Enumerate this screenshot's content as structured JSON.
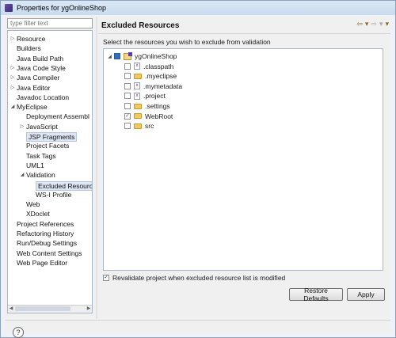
{
  "window": {
    "title": "Properties for ygOnlineShop"
  },
  "filter": {
    "placeholder": "type filter text"
  },
  "nav_tree": [
    {
      "label": "Resource",
      "indent": 0,
      "arrow": "▷"
    },
    {
      "label": "Builders",
      "indent": 0,
      "arrow": ""
    },
    {
      "label": "Java Build Path",
      "indent": 0,
      "arrow": ""
    },
    {
      "label": "Java Code Style",
      "indent": 0,
      "arrow": "▷"
    },
    {
      "label": "Java Compiler",
      "indent": 0,
      "arrow": "▷"
    },
    {
      "label": "Java Editor",
      "indent": 0,
      "arrow": "▷"
    },
    {
      "label": "Javadoc Location",
      "indent": 0,
      "arrow": ""
    },
    {
      "label": "MyEclipse",
      "indent": 0,
      "arrow": "◢"
    },
    {
      "label": "Deployment Assembl",
      "indent": 1,
      "arrow": ""
    },
    {
      "label": "JavaScript",
      "indent": 1,
      "arrow": "▷"
    },
    {
      "label": "JSP Fragments",
      "indent": 1,
      "arrow": "",
      "selected": true
    },
    {
      "label": "Project Facets",
      "indent": 1,
      "arrow": ""
    },
    {
      "label": "Task Tags",
      "indent": 1,
      "arrow": ""
    },
    {
      "label": "UML1",
      "indent": 1,
      "arrow": ""
    },
    {
      "label": "Validation",
      "indent": 1,
      "arrow": "◢"
    },
    {
      "label": "Excluded Resourc",
      "indent": 2,
      "arrow": "",
      "selected": true
    },
    {
      "label": "WS-I Profile",
      "indent": 2,
      "arrow": ""
    },
    {
      "label": "Web",
      "indent": 1,
      "arrow": ""
    },
    {
      "label": "XDoclet",
      "indent": 1,
      "arrow": ""
    },
    {
      "label": "Project References",
      "indent": 0,
      "arrow": ""
    },
    {
      "label": "Refactoring History",
      "indent": 0,
      "arrow": ""
    },
    {
      "label": "Run/Debug Settings",
      "indent": 0,
      "arrow": ""
    },
    {
      "label": "Web Content Settings",
      "indent": 0,
      "arrow": ""
    },
    {
      "label": "Web Page Editor",
      "indent": 0,
      "arrow": ""
    }
  ],
  "page": {
    "title": "Excluded Resources",
    "instruction": "Select the resources you wish to exclude from validation",
    "nav_icons": [
      "back-arrow-icon",
      "dropdown-icon",
      "forward-arrow-icon",
      "dropdown-icon",
      "menu-icon"
    ]
  },
  "resources": [
    {
      "label": "ygOnlineShop",
      "type": "project",
      "checked": "partial",
      "indent": 0,
      "arrow": "◢"
    },
    {
      "label": ".classpath",
      "type": "file",
      "checked": false,
      "indent": 1,
      "arrow": ""
    },
    {
      "label": ".myeclipse",
      "type": "folder",
      "checked": false,
      "indent": 1,
      "arrow": ""
    },
    {
      "label": ".mymetadata",
      "type": "file",
      "checked": false,
      "indent": 1,
      "arrow": ""
    },
    {
      "label": ".project",
      "type": "file",
      "checked": false,
      "indent": 1,
      "arrow": ""
    },
    {
      "label": ".settings",
      "type": "folder",
      "checked": false,
      "indent": 1,
      "arrow": ""
    },
    {
      "label": "WebRoot",
      "type": "folder",
      "checked": true,
      "indent": 1,
      "arrow": ""
    },
    {
      "label": "src",
      "type": "folder",
      "checked": false,
      "indent": 1,
      "arrow": ""
    }
  ],
  "revalidate": {
    "label": "Revalidate project when excluded resource list is modified",
    "checked": true
  },
  "buttons": {
    "restore": "Restore Defaults",
    "apply": "Apply"
  },
  "help": {
    "glyph": "?"
  }
}
